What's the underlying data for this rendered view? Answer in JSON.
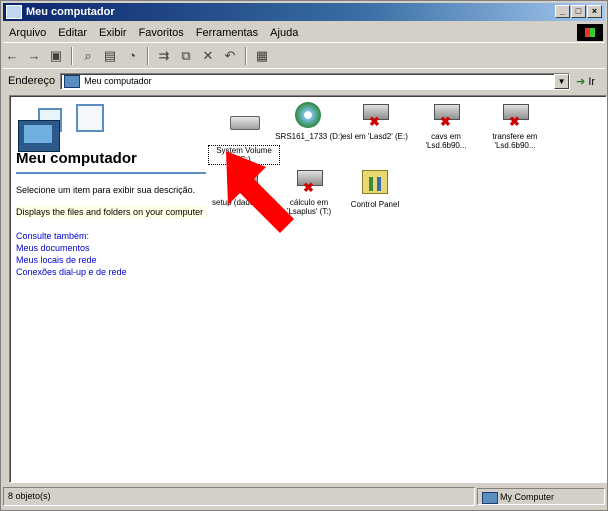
{
  "window": {
    "title": "Meu computador"
  },
  "menubar": [
    "Arquivo",
    "Editar",
    "Exibir",
    "Favoritos",
    "Ferramentas",
    "Ajuda"
  ],
  "toolbar": {
    "buttons": [
      "back-icon",
      "forward-icon",
      "up-icon",
      "search-icon",
      "folders-icon",
      "history-icon",
      "move-to-icon",
      "copy-to-icon",
      "delete-icon",
      "undo-icon",
      "views-icon"
    ]
  },
  "address": {
    "label": "Endereço",
    "value": "Meu computador",
    "go_label": "Ir"
  },
  "left_panel": {
    "title": "Meu computador",
    "description": "Selecione um item para exibir sua descrição.",
    "info": "Displays the files and folders on your computer",
    "links_heading": "Consulte também:",
    "links": [
      "Meus documentos",
      "Meus locais de rede",
      "Conexões dial-up e de rede"
    ]
  },
  "items": [
    {
      "label": "System Volume (C:)",
      "icon": "hard-drive-icon",
      "selected": true
    },
    {
      "label": "SRS161_1733 (D:)",
      "icon": "cd-drive-icon"
    },
    {
      "label": "esl em 'Lasd2' (E:)",
      "icon": "network-drive-icon"
    },
    {
      "label": "cavs em 'Lsd.6b90...",
      "icon": "network-drive-icon"
    },
    {
      "label": "transfere em 'Lsd.6b90...",
      "icon": "network-drive-icon"
    },
    {
      "label": "setup (dados) (S:)",
      "icon": "network-drive-icon"
    },
    {
      "label": "cálculo em 'Lsaplus' (T:)",
      "icon": "network-drive-icon"
    },
    {
      "label": "Control Panel",
      "icon": "control-panel-icon"
    }
  ],
  "status": {
    "left": "8 objeto(s)",
    "right": "My Computer"
  },
  "colors": {
    "titlebar_start": "#0a246a",
    "titlebar_end": "#a6caf0",
    "link": "#0000cc",
    "arrow": "#ff0000"
  }
}
